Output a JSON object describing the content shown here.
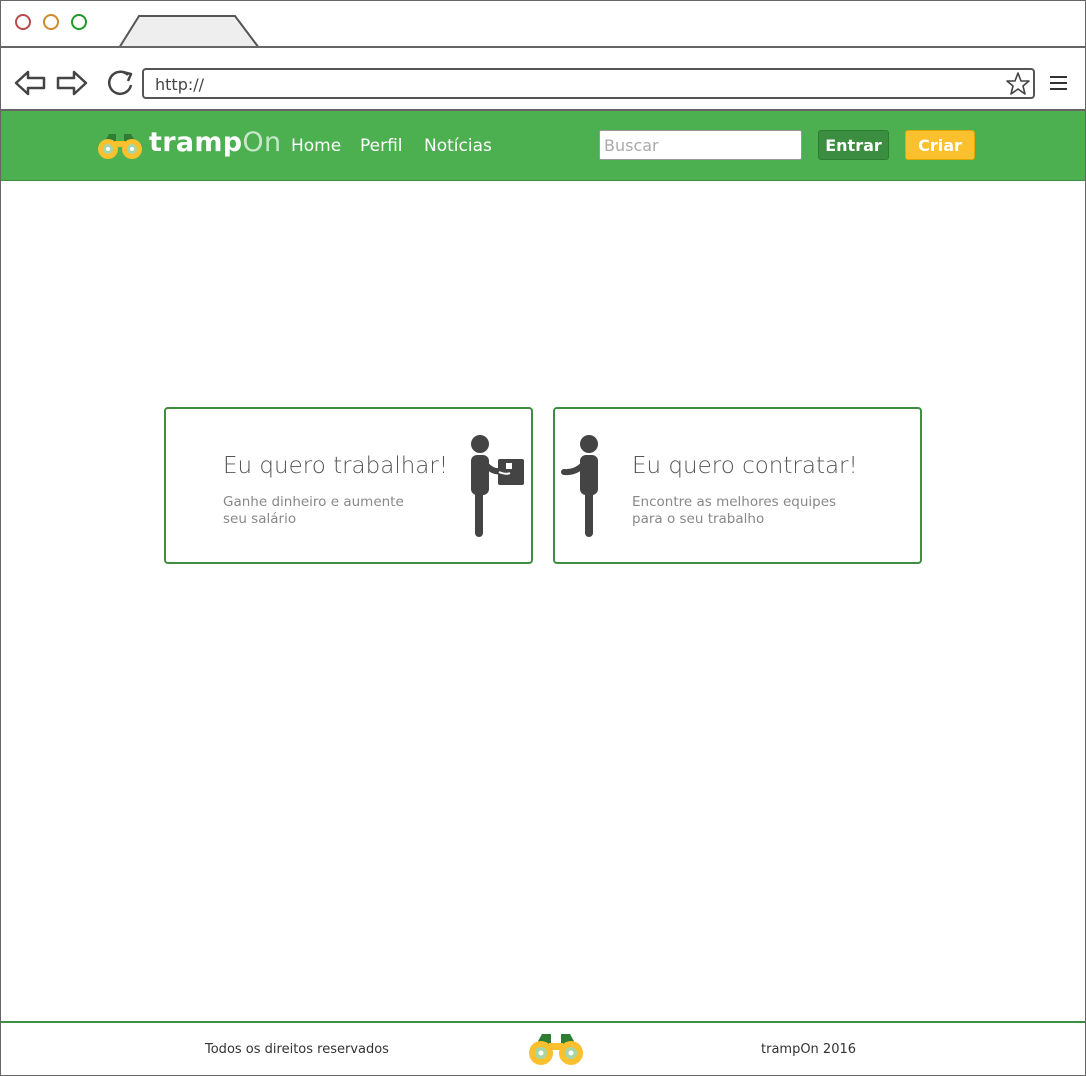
{
  "browser": {
    "url": "http://"
  },
  "site": {
    "brand_main": "tramp",
    "brand_accent": "On",
    "nav": {
      "home": "Home",
      "perfil": "Perfil",
      "noticias": "Notícias"
    },
    "search_placeholder": "Buscar",
    "entrar_label": "Entrar",
    "criar_label": "Criar",
    "colors": {
      "primary": "#4caf50",
      "primary_dark": "#3b8e3f",
      "accent": "#fbc02d"
    }
  },
  "cards": {
    "work": {
      "title": "Eu quero trabalhar!",
      "subtitle_line1": "Ganhe dinheiro e aumente",
      "subtitle_line2": "seu salário"
    },
    "hire": {
      "title": "Eu quero contratar!",
      "subtitle_line1": "Encontre as melhores equipes",
      "subtitle_line2": "para o seu trabalho"
    }
  },
  "footer": {
    "rights": "Todos os direitos reservados",
    "copyright": "trampOn 2016"
  }
}
